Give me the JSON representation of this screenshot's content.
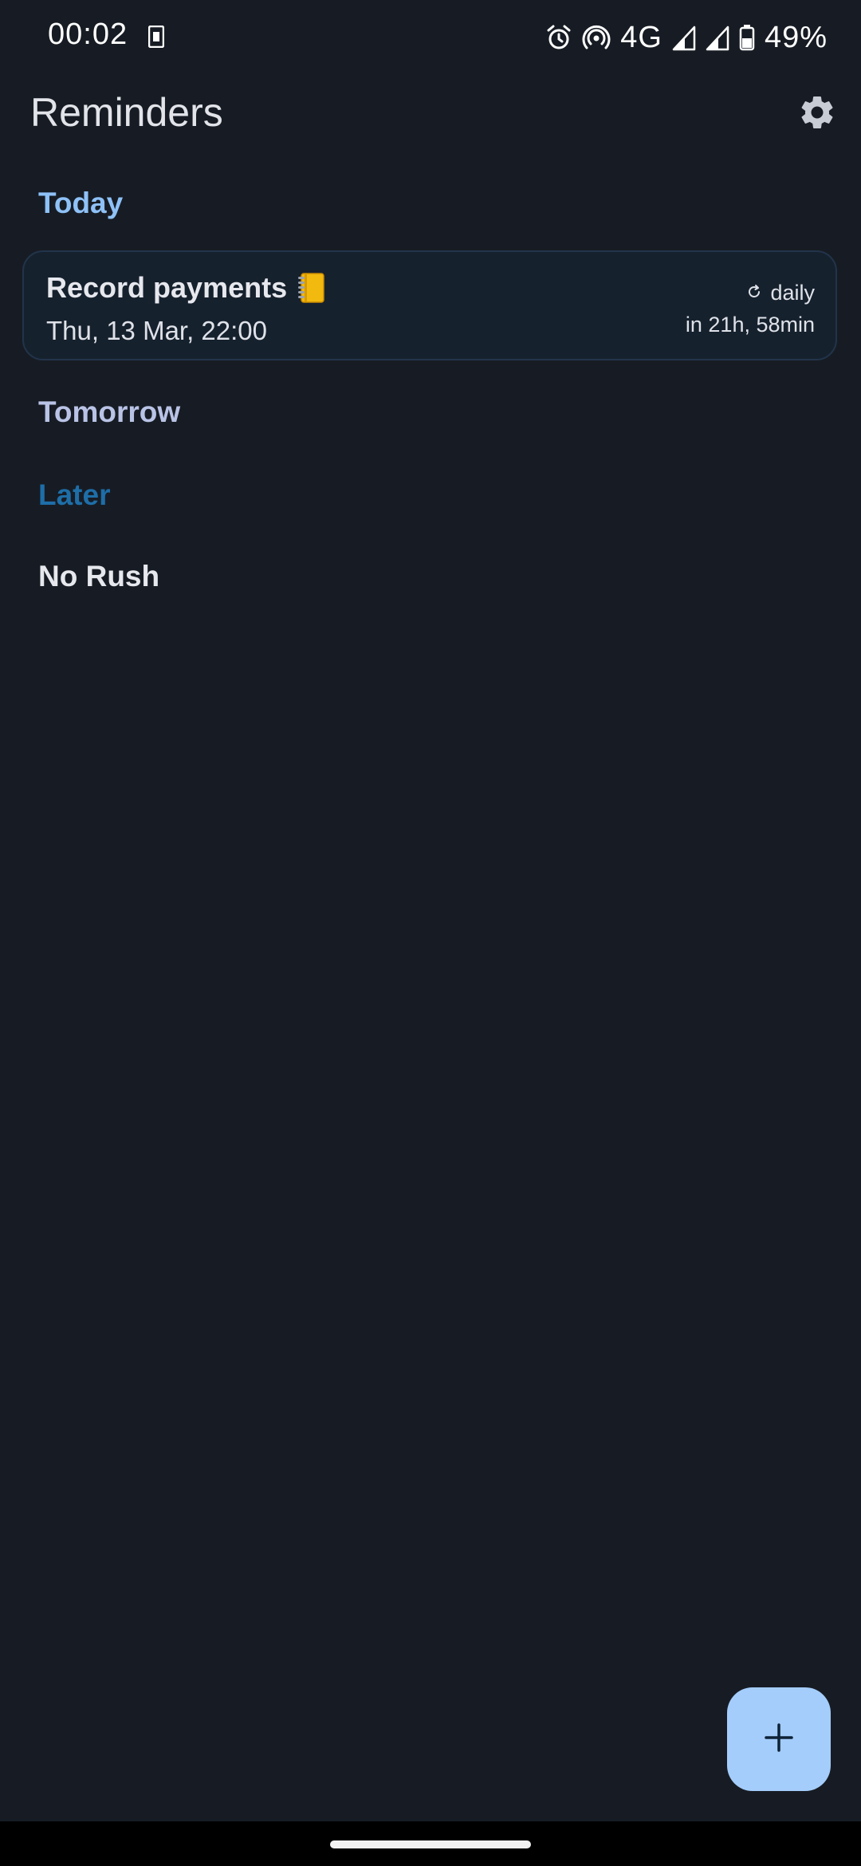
{
  "status_bar": {
    "time": "00:02",
    "network": "4G",
    "battery_percent": "49%",
    "icons": [
      "sim-card-icon",
      "alarm-icon",
      "hotspot-icon",
      "signal-icon",
      "signal-icon",
      "battery-icon"
    ]
  },
  "app_bar": {
    "title": "Reminders",
    "settings_icon": "gear-icon"
  },
  "sections": {
    "today": "Today",
    "tomorrow": "Tomorrow",
    "later": "Later",
    "no_rush": "No Rush"
  },
  "reminders": [
    {
      "title": "Record payments",
      "emoji": "ledger-notebook",
      "datetime": "Thu, 13 Mar, 22:00",
      "repeat": "daily",
      "due_in": "in 21h, 58min",
      "section": "today"
    }
  ],
  "fab": {
    "icon": "plus-icon"
  },
  "colors": {
    "background": "#171c24",
    "today_header": "#8ec1f7",
    "tomorrow_header": "#b9c3e6",
    "later_header": "#1e6ea8",
    "card_bg": "#16212e",
    "fab_bg": "#a4cdfb"
  }
}
